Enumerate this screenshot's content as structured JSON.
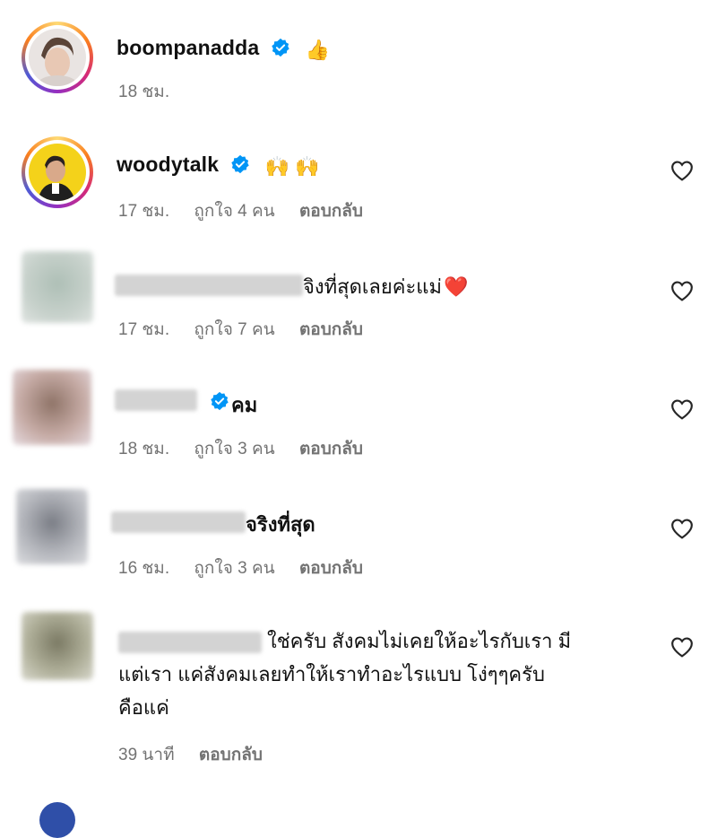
{
  "comments": [
    {
      "username": "boompanadda",
      "verified": true,
      "text": "👍",
      "time": "18 ชม.",
      "likes": "",
      "reply_label": "",
      "has_heart": false
    },
    {
      "username": "woodytalk",
      "verified": true,
      "text": "🙌 🙌",
      "time": "17 ชม.",
      "likes": "ถูกใจ 4 คน",
      "reply_label": "ตอบกลับ",
      "has_heart": true
    },
    {
      "username": "",
      "verified": false,
      "text": "จิงที่สุดเลยค่ะแม่",
      "emoji": "❤️",
      "time": "17 ชม.",
      "likes": "ถูกใจ 7 คน",
      "reply_label": "ตอบกลับ",
      "has_heart": true
    },
    {
      "username": "",
      "verified": true,
      "text": "คม",
      "time": "18 ชม.",
      "likes": "ถูกใจ 3 คน",
      "reply_label": "ตอบกลับ",
      "has_heart": true
    },
    {
      "username": "",
      "verified": false,
      "text": "จริงที่สุด",
      "time": "16 ชม.",
      "likes": "ถูกใจ 3 คน",
      "reply_label": "ตอบกลับ",
      "has_heart": true
    },
    {
      "username": "",
      "verified": false,
      "text_lines": [
        "ใช่ครับ สังคมไม่เคยให้อะไรกับเรา มี",
        "แต่เรา แค่สังคมเลยทำให้เราทำอะไรแบบ โง่ๆๆครับ",
        "คือแค่"
      ],
      "time": "39 นาที",
      "likes": "",
      "reply_label": "ตอบกลับ",
      "has_heart": true
    }
  ],
  "colors": {
    "verified_blue": "#0095f6",
    "meta_gray": "#737373",
    "heart_pink": "#ed4956"
  }
}
